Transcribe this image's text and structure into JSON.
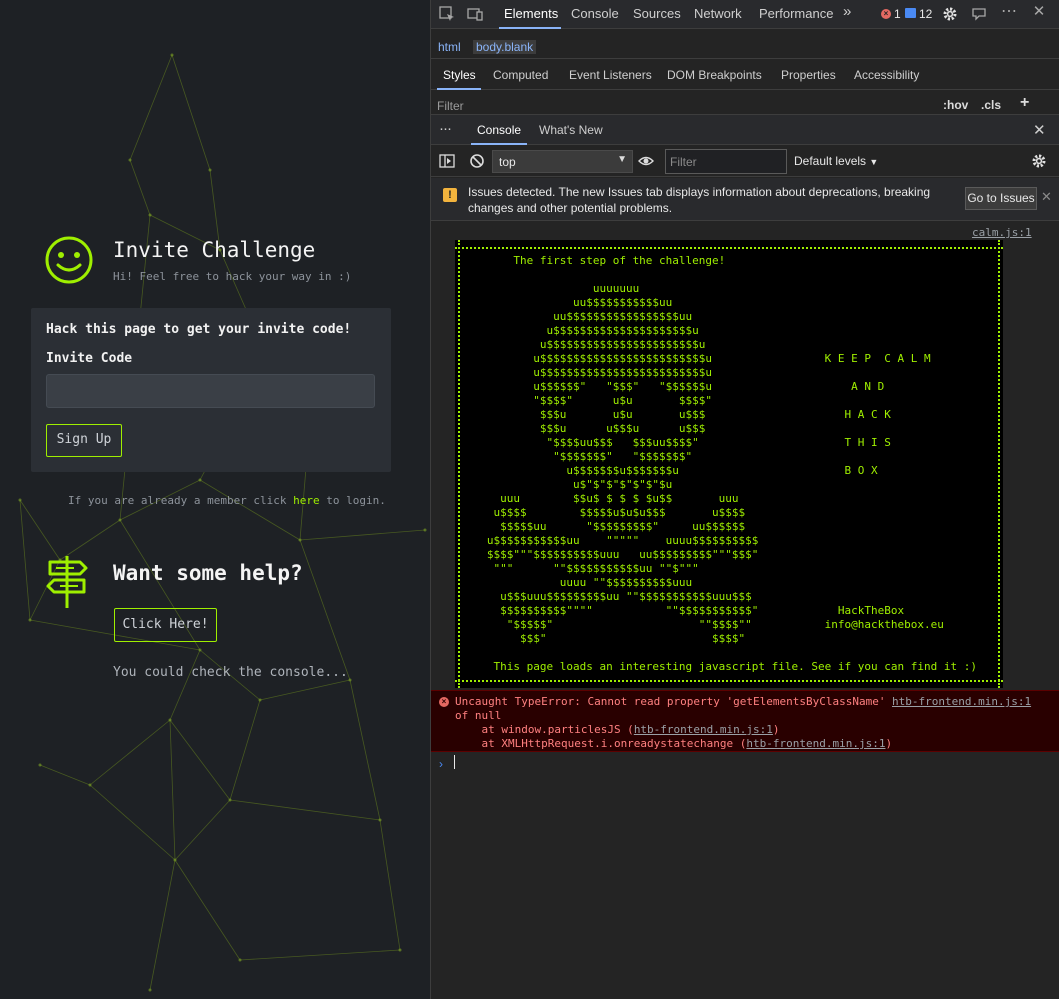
{
  "page": {
    "title": "Invite Challenge",
    "subtitle": "Hi! Feel free to hack your way in :)",
    "card_heading": "Hack this page to get your invite code!",
    "invite_label": "Invite Code",
    "invite_value": "",
    "signup_label": "Sign Up",
    "member_prefix": "If you are already a member click ",
    "member_link": "here",
    "member_suffix": " to login.",
    "help_title": "Want some help?",
    "click_here_label": "Click Here!",
    "console_hint": "You could check the console...",
    "accent": "#9fef00"
  },
  "devtools": {
    "tabs": [
      "Elements",
      "Console",
      "Sources",
      "Network",
      "Performance"
    ],
    "more_tabs": "»",
    "error_count": "1",
    "message_count": "12",
    "breadcrumbs": [
      "html",
      "body.blank"
    ],
    "subtabs": [
      "Styles",
      "Computed",
      "Event Listeners",
      "DOM Breakpoints",
      "Properties",
      "Accessibility"
    ],
    "styles_filter_placeholder": "Filter",
    "hov": ":hov",
    "cls": ".cls",
    "plus": "+",
    "drawer_more": "⋮",
    "drawer_tabs": [
      "Console",
      "What's New"
    ],
    "context": "top",
    "console_filter_placeholder": "Filter",
    "levels": "Default levels",
    "issues_text": "Issues detected. The new Issues tab displays information about deprecations, breaking changes and other potential problems.",
    "goto_issues": "Go to Issues",
    "log_source": "calm.js:1",
    "ascii_art": "\n       The first step of the challenge!\n\n                   uuuuuuu\n                uu$$$$$$$$$$$uu\n             uu$$$$$$$$$$$$$$$$$uu\n            u$$$$$$$$$$$$$$$$$$$$$u\n           u$$$$$$$$$$$$$$$$$$$$$$$u\n          u$$$$$$$$$$$$$$$$$$$$$$$$$u                 K E E P  C A L M\n          u$$$$$$$$$$$$$$$$$$$$$$$$$u\n          u$$$$$$\"   \"$$$\"   \"$$$$$$u                     A N D\n          \"$$$$\"      u$u       $$$$\"\n           $$$u       u$u       u$$$                     H A C K\n           $$$u      u$$$u      u$$$\n            \"$$$$uu$$$   $$$uu$$$$\"                      T H I S\n             \"$$$$$$$\"   \"$$$$$$$\"\n               u$$$$$$$u$$$$$$$u                         B O X\n                u$\"$\"$\"$\"$\"$\"$u\n     uuu        $$u$ $ $ $ $u$$       uuu\n    u$$$$        $$$$$u$u$u$$$       u$$$$\n     $$$$$uu      \"$$$$$$$$$\"     uu$$$$$$\n   u$$$$$$$$$$$uu    \"\"\"\"\"    uuuu$$$$$$$$$$\n   $$$$\"\"\"$$$$$$$$$$uuu   uu$$$$$$$$$\"\"\"$$$\"\n    \"\"\"      \"\"$$$$$$$$$$$uu \"\"$\"\"\"\n              uuuu \"\"$$$$$$$$$$uuu\n     u$$$uuu$$$$$$$$$uu \"\"$$$$$$$$$$$uuu$$$\n     $$$$$$$$$$\"\"\"\"           \"\"$$$$$$$$$$$\"            HackTheBox\n      \"$$$$$\"                      \"\"$$$$\"\"           info@hackthebox.eu\n        $$$\"                         $$$$\"\n\n    This page loads an interesting javascript file. See if you can find it :)",
    "error_message": "Uncaught TypeError: Cannot read property 'getElementsByClassName'",
    "error_message_cont": "of null",
    "error_source": "htb-frontend.min.js:1",
    "stack": [
      {
        "prefix": "    at window.particlesJS (",
        "link": "htb-frontend.min.js:1",
        "suffix": ")"
      },
      {
        "prefix": "    at XMLHttpRequest.i.onreadystatechange (",
        "link": "htb-frontend.min.js:1",
        "suffix": ")"
      }
    ],
    "prompt": "›",
    "colors": {
      "error_bg": "#290000",
      "link_blue": "#8ab4f8",
      "accent": "#9fef00"
    }
  }
}
